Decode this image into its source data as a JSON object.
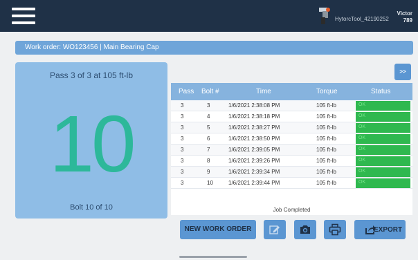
{
  "header": {
    "tool_name": "HytorcTool_42190252",
    "user_line1": "Victor",
    "user_line2": "789"
  },
  "work_order": "Work order: WO123456 | Main Bearing Cap",
  "counter": {
    "pass_text": "Pass 3 of 3 at 105 ft-lb",
    "bolt_number": "10",
    "bolt_text": "Bolt 10 of 10"
  },
  "expand_label": ">>",
  "table": {
    "columns": [
      "Pass",
      "Bolt #",
      "Time",
      "Torque",
      "Status"
    ],
    "rows": [
      {
        "pass": "3",
        "bolt": "3",
        "time": "1/6/2021 2:38:08 PM",
        "torque": "105 ft-lb",
        "status": "OK"
      },
      {
        "pass": "3",
        "bolt": "4",
        "time": "1/6/2021 2:38:18 PM",
        "torque": "105 ft-lb",
        "status": "OK"
      },
      {
        "pass": "3",
        "bolt": "5",
        "time": "1/6/2021 2:38:27 PM",
        "torque": "105 ft-lb",
        "status": "OK"
      },
      {
        "pass": "3",
        "bolt": "6",
        "time": "1/6/2021 2:38:50 PM",
        "torque": "105 ft-lb",
        "status": "OK"
      },
      {
        "pass": "3",
        "bolt": "7",
        "time": "1/6/2021 2:39:05 PM",
        "torque": "105 ft-lb",
        "status": "OK"
      },
      {
        "pass": "3",
        "bolt": "8",
        "time": "1/6/2021 2:39:26 PM",
        "torque": "105 ft-lb",
        "status": "OK"
      },
      {
        "pass": "3",
        "bolt": "9",
        "time": "1/6/2021 2:39:34 PM",
        "torque": "105 ft-lb",
        "status": "OK"
      },
      {
        "pass": "3",
        "bolt": "10",
        "time": "1/6/2021 2:39:44 PM",
        "torque": "105 ft-lb",
        "status": "OK"
      }
    ],
    "footer": "Job Completed"
  },
  "buttons": {
    "new_work_order": "NEW WORK ORDER",
    "export": "EXPORT"
  },
  "colors": {
    "header_bg": "#1f3147",
    "accent": "#5b96d2",
    "status_ok": "#2fb84f",
    "big_number": "#2db89a"
  }
}
